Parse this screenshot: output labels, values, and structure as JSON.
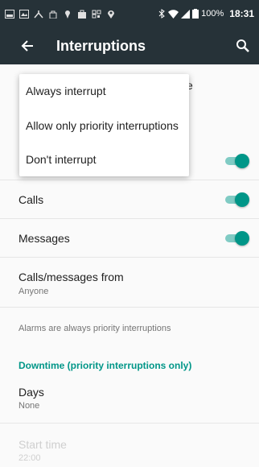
{
  "status_bar": {
    "battery": "100%",
    "time": "18:31",
    "icons": [
      "image-icon",
      "gallery-icon",
      "hanger-icon",
      "lock-icon",
      "location-pin-icon",
      "shopping-bag-icon",
      "qr-icon",
      "map-pin-icon",
      "bluetooth-icon",
      "wifi-icon",
      "signal-icon",
      "battery-icon"
    ]
  },
  "app_bar": {
    "title": "Interruptions"
  },
  "menu": {
    "items": [
      {
        "label": "Always interrupt"
      },
      {
        "label": "Allow only priority interruptions"
      },
      {
        "label": "Don't interrupt"
      }
    ]
  },
  "list": {
    "behind_text": "e",
    "calls": {
      "label": "Calls",
      "enabled": true
    },
    "messages": {
      "label": "Messages",
      "enabled": true
    },
    "calls_messages_from": {
      "label": "Calls/messages from",
      "value": "Anyone"
    },
    "alarms_note": "Alarms are always priority interruptions",
    "downtime_header": "Downtime (priority interruptions only)",
    "days": {
      "label": "Days",
      "value": "None"
    },
    "start_time": {
      "label": "Start time",
      "value": "22:00"
    }
  },
  "colors": {
    "accent": "#009688",
    "appbar": "#263238"
  }
}
